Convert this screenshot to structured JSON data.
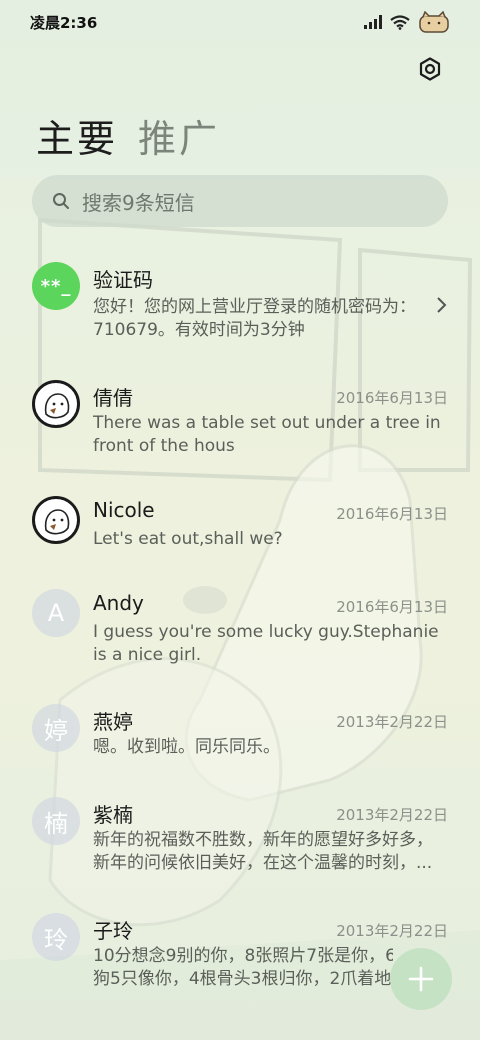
{
  "status_bar": {
    "time": "凌晨2:36"
  },
  "header": {
    "settings_icon": "gear-icon",
    "tabs": [
      {
        "label": "主要",
        "active": true
      },
      {
        "label": "推广",
        "active": false
      }
    ]
  },
  "search": {
    "placeholder": "搜索9条短信",
    "icon": "search-icon"
  },
  "conversations": [
    {
      "name": "验证码",
      "avatar_text": "**_",
      "avatar_type": "code",
      "date": "",
      "preview_lines": [
        "您好！您的网上营业厅登录的随机密码为：",
        "710679。有效时间为3分钟"
      ],
      "chevron": "chevron-right-icon"
    },
    {
      "name": "倩倩",
      "avatar_type": "photo",
      "date": "2016年6月13日",
      "preview_lines": [
        "There was a table set out under a tree in",
        "front of the hous"
      ]
    },
    {
      "name": "Nicole",
      "avatar_type": "photo",
      "date": "2016年6月13日",
      "preview_lines": [
        "Let's eat out,shall we?"
      ]
    },
    {
      "name": "Andy",
      "avatar_text": "A",
      "avatar_type": "letter",
      "date": "2016年6月13日",
      "preview_lines": [
        "I guess you're some lucky guy.Stephanie",
        "is a nice girl."
      ]
    },
    {
      "name": "燕婷",
      "avatar_text": "婷",
      "avatar_type": "letter",
      "date": "2013年2月22日",
      "preview_lines": [
        "嗯。收到啦。同乐同乐。"
      ]
    },
    {
      "name": "紫楠",
      "avatar_text": "楠",
      "avatar_type": "letter",
      "date": "2013年2月22日",
      "preview_lines": [
        "新年的祝福数不胜数，新年的愿望好多好多，",
        "新年的问候依旧美好，在这个温馨的时刻，..."
      ]
    },
    {
      "name": "子玲",
      "avatar_text": "玲",
      "avatar_type": "letter",
      "date": "2013年2月22日",
      "preview_lines": [
        "10分想念9别的你，8张照片7张是你，6",
        "狗5只像你，4根骨头3根归你，2爪着地"
      ]
    }
  ],
  "fab": {
    "icon": "plus-icon"
  }
}
